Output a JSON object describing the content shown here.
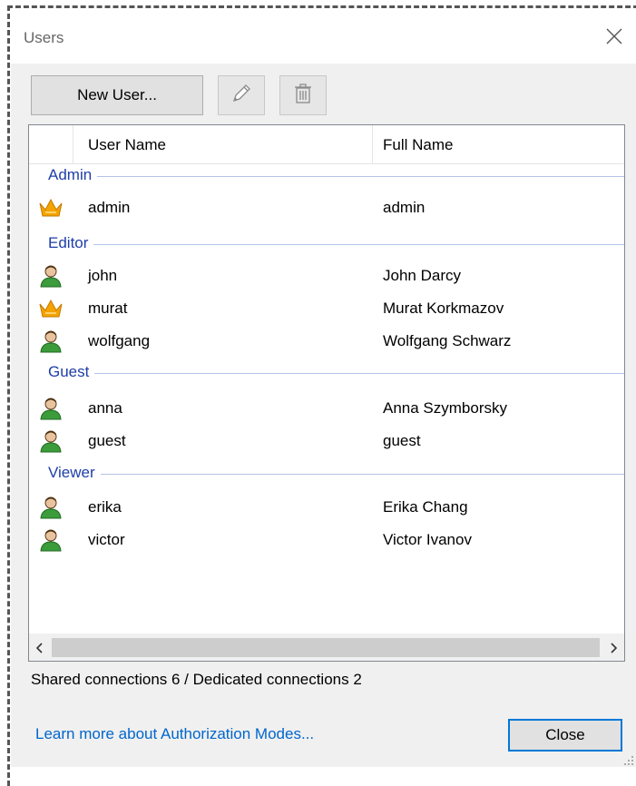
{
  "window": {
    "title": "Users"
  },
  "toolbar": {
    "new_user_label": "New User...",
    "edit_icon": "pencil-icon",
    "delete_icon": "trash-icon"
  },
  "grid": {
    "columns": [
      "User Name",
      "Full Name"
    ],
    "groups": [
      {
        "name": "Admin",
        "rows": [
          {
            "icon": "crown-icon",
            "user": "admin",
            "full": "admin"
          }
        ]
      },
      {
        "name": "Editor",
        "rows": [
          {
            "icon": "user-icon",
            "user": "john",
            "full": "John Darcy"
          },
          {
            "icon": "crown-icon",
            "user": "murat",
            "full": "Murat Korkmazov"
          },
          {
            "icon": "user-icon",
            "user": "wolfgang",
            "full": "Wolfgang Schwarz"
          }
        ]
      },
      {
        "name": "Guest",
        "rows": [
          {
            "icon": "user-icon",
            "user": "anna",
            "full": "Anna Szymborsky"
          },
          {
            "icon": "user-icon",
            "user": "guest",
            "full": "guest"
          }
        ]
      },
      {
        "name": "Viewer",
        "rows": [
          {
            "icon": "user-icon",
            "user": "erika",
            "full": "Erika Chang"
          },
          {
            "icon": "user-icon",
            "user": "victor",
            "full": "Victor Ivanov"
          }
        ]
      }
    ]
  },
  "status": "Shared connections 6 / Dedicated connections 2",
  "footer": {
    "link_label": "Learn more about Authorization Modes...",
    "close_label": "Close"
  },
  "colors": {
    "group_header": "#1e3ea8",
    "link": "#0066cc",
    "crown": "#f5a300",
    "user": "#3c9c3c",
    "focus_border": "#0078d7"
  }
}
